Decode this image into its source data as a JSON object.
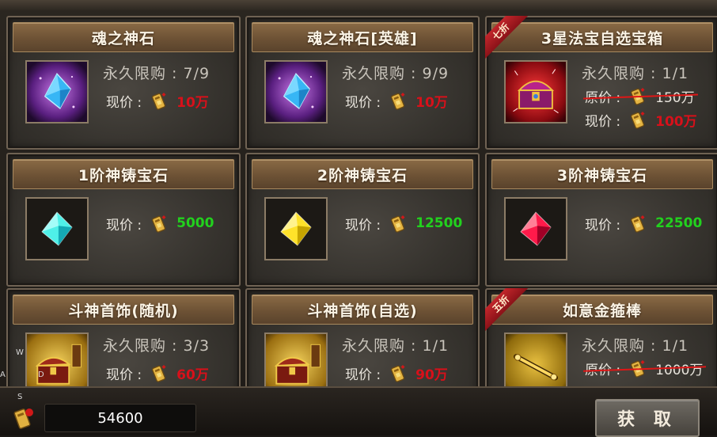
{
  "colors": {
    "price_red": "#d8101a",
    "price_green": "#22d11e",
    "header_brown": "#7a5b3c",
    "strike_red": "#e01616"
  },
  "limit_label": "永久限购 : ",
  "now_label": "现价 :",
  "orig_label": "原价 :",
  "items": [
    {
      "title": "魂之神石",
      "icon": "purple-gem-icon",
      "limit": "7/9",
      "price": "10万",
      "price_color": "red"
    },
    {
      "title": "魂之神石[英雄]",
      "icon": "purple-gem-icon",
      "limit": "9/9",
      "price": "10万",
      "price_color": "red"
    },
    {
      "title": "3星法宝自选宝箱",
      "icon": "treasure-chest-icon",
      "badge": "七折",
      "limit": "1/1",
      "orig_price": "150万",
      "price": "100万",
      "price_color": "red"
    },
    {
      "title": "1阶神铸宝石",
      "icon": "cyan-gem-icon",
      "price": "5000",
      "price_color": "green"
    },
    {
      "title": "2阶神铸宝石",
      "icon": "yellow-gem-icon",
      "price": "12500",
      "price_color": "green"
    },
    {
      "title": "3阶神铸宝石",
      "icon": "red-gem-icon",
      "price": "22500",
      "price_color": "green"
    },
    {
      "title": "斗神首饰(随机)",
      "icon": "jewelry-chest-icon",
      "limit": "3/3",
      "price": "60万",
      "price_color": "red"
    },
    {
      "title": "斗神首饰(自选)",
      "icon": "jewelry-chest-icon",
      "limit": "1/1",
      "price": "90万",
      "price_color": "red"
    },
    {
      "title": "如意金箍棒",
      "icon": "golden-staff-icon",
      "badge": "五折",
      "limit": "1/1",
      "orig_price": "1000万"
    }
  ],
  "footer": {
    "balance": "54600",
    "get_button": "获 取"
  },
  "debug_keys": [
    "W",
    "A",
    "D",
    "S"
  ]
}
